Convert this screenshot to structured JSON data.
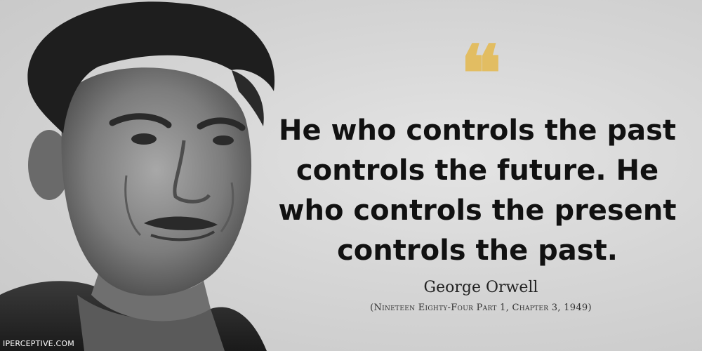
{
  "quote": {
    "mark": "❝",
    "lines": [
      "He who controls the past",
      "controls the future. He",
      "who controls the present",
      "controls the past."
    ]
  },
  "author": {
    "name": "George Orwell",
    "source": "(Nineteen Eighty-Four Part 1, Chapter 3, 1949)"
  },
  "watermark": "IPERCEPTIVE.COM",
  "colors": {
    "quote_mark": "#e2bd62",
    "text": "#111111"
  }
}
